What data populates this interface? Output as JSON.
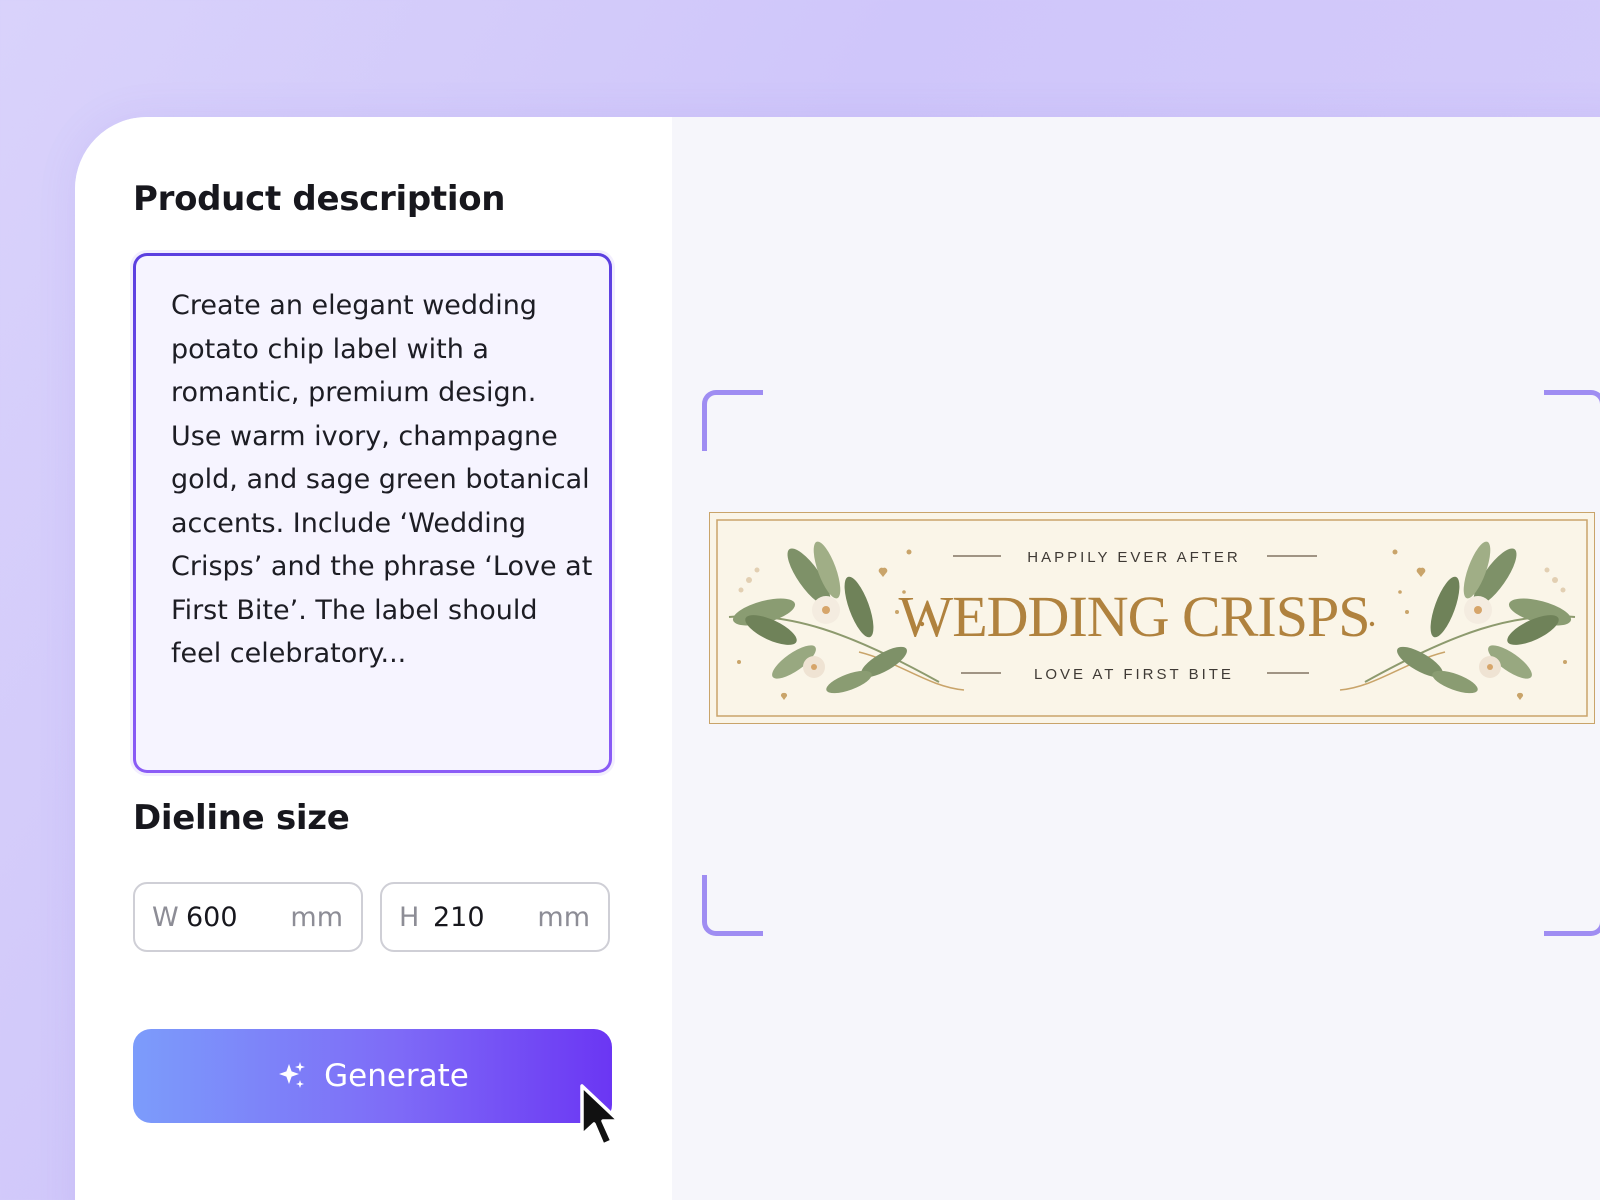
{
  "description_section": {
    "title": "Product description",
    "text": "Create an elegant wedding potato chip label with a romantic, premium design. Use warm ivory, champagne gold, and sage green botanical accents. Include ‘Wedding Crisps’ and the phrase ‘Love at First Bite’. The label should feel celebratory..."
  },
  "dieline_section": {
    "title": "Dieline size",
    "width": {
      "axis": "W",
      "value": "600",
      "unit": "mm"
    },
    "height": {
      "axis": "H",
      "value": "210",
      "unit": "mm"
    }
  },
  "generate_button": {
    "label": "Generate",
    "icon": "sparkle-icon"
  },
  "preview": {
    "tagline_top": "HAPPILY EVER AFTER",
    "product_name": "WEDDING CRISPS",
    "tagline_bottom": "LOVE AT FIRST BITE",
    "colors": {
      "ivory": "#faf5e8",
      "champagne_gold": "#b88a45",
      "sage_green": "#7a8f64"
    }
  },
  "theme": {
    "accent": "#6b36f3",
    "background": "#d6cdfb"
  }
}
